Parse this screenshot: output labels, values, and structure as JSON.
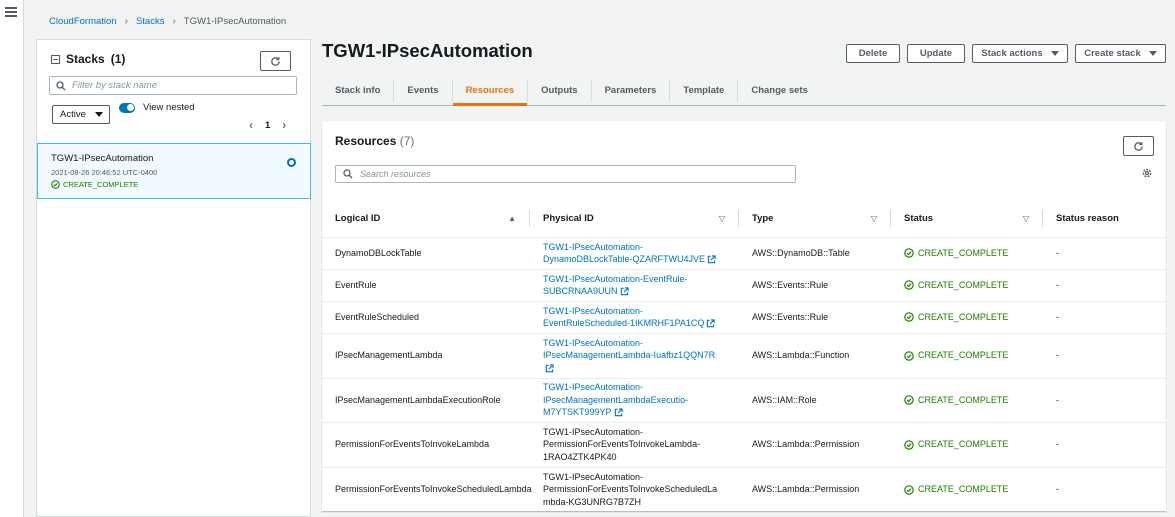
{
  "breadcrumb": {
    "items": [
      "CloudFormation",
      "Stacks"
    ],
    "current": "TGW1-IPsecAutomation"
  },
  "stacks_panel": {
    "title": "Stacks",
    "count": "(1)",
    "filter_placeholder": "Filter by stack name",
    "status_filter": "Active",
    "view_nested_label": "View nested",
    "view_nested_on": true,
    "page": "1",
    "stack": {
      "name": "TGW1-IPsecAutomation",
      "date": "2021-08-26 20:46:52 UTC-0400",
      "status": "CREATE_COMPLETE"
    }
  },
  "main": {
    "title": "TGW1-IPsecAutomation",
    "buttons": {
      "delete": "Delete",
      "update": "Update",
      "stack_actions": "Stack actions",
      "create_stack": "Create stack"
    },
    "tabs": [
      "Stack info",
      "Events",
      "Resources",
      "Outputs",
      "Parameters",
      "Template",
      "Change sets"
    ],
    "active_tab": "Resources"
  },
  "resources": {
    "title": "Resources",
    "count": "(7)",
    "search_placeholder": "Search resources",
    "columns": [
      "Logical ID",
      "Physical ID",
      "Type",
      "Status",
      "Status reason"
    ],
    "rows": [
      {
        "logical_id": "DynamoDBLockTable",
        "physical_lines": [
          "TGW1-IPsecAutomation-",
          "DynamoDBLockTable-QZARFTWU4JVE"
        ],
        "link": true,
        "type": "AWS::DynamoDB::Table",
        "status": "CREATE_COMPLETE",
        "reason": "-"
      },
      {
        "logical_id": "EventRule",
        "physical_lines": [
          "TGW1-IPsecAutomation-EventRule-",
          "SUBCRNAA9UUN"
        ],
        "link": true,
        "type": "AWS::Events::Rule",
        "status": "CREATE_COMPLETE",
        "reason": "-"
      },
      {
        "logical_id": "EventRuleScheduled",
        "physical_lines": [
          "TGW1-IPsecAutomation-",
          "EventRuleScheduled-1IKMRHF1PA1CQ"
        ],
        "link": true,
        "type": "AWS::Events::Rule",
        "status": "CREATE_COMPLETE",
        "reason": "-"
      },
      {
        "logical_id": "IPsecManagementLambda",
        "physical_lines": [
          "TGW1-IPsecAutomation-",
          "IPsecManagementLambda-Iuafbz1QQN7R",
          ""
        ],
        "link": true,
        "type": "AWS::Lambda::Function",
        "status": "CREATE_COMPLETE",
        "reason": "-"
      },
      {
        "logical_id": "IPsecManagementLambdaExecutionRole",
        "physical_lines": [
          "TGW1-IPsecAutomation-",
          "IPsecManagementLambdaExecutio-",
          "M7YTSKT999YP"
        ],
        "link": true,
        "type": "AWS::IAM::Role",
        "status": "CREATE_COMPLETE",
        "reason": "-"
      },
      {
        "logical_id": "PermissionForEventsToInvokeLambda",
        "physical_lines": [
          "TGW1-IPsecAutomation-",
          "PermissionForEventsToInvokeLambda-",
          "1RAO4ZTK4PK40"
        ],
        "link": false,
        "type": "AWS::Lambda::Permission",
        "status": "CREATE_COMPLETE",
        "reason": "-"
      },
      {
        "logical_id": "PermissionForEventsToInvokeScheduledLambda",
        "physical_lines": [
          "TGW1-IPsecAutomation-",
          "PermissionForEventsToInvokeScheduledLa",
          "mbda-KG3UNRG7B7ZH"
        ],
        "link": false,
        "type": "AWS::Lambda::Permission",
        "status": "CREATE_COMPLETE",
        "reason": "-"
      }
    ]
  }
}
